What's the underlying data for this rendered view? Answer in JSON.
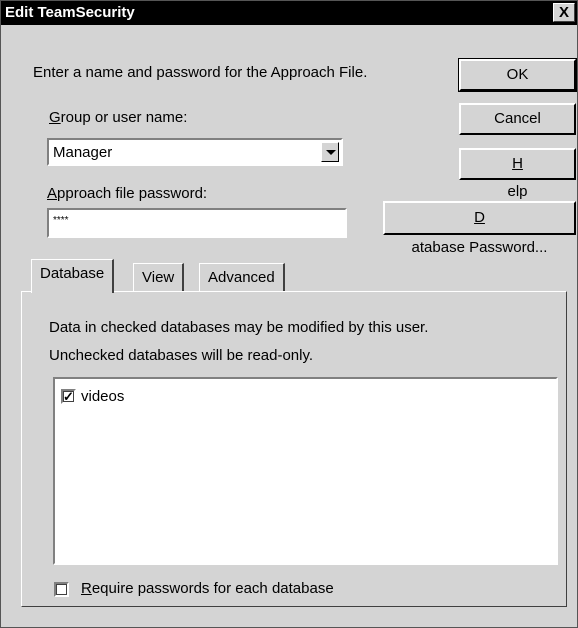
{
  "window": {
    "title": "Edit TeamSecurity",
    "close_label": "X"
  },
  "intro_text": "Enter a name and password for the Approach File.",
  "group": {
    "label_first": "G",
    "label_rest": "roup or user name:",
    "selected_value": "Manager"
  },
  "password": {
    "label_first": "A",
    "label_rest": "pproach file password:",
    "value": "****"
  },
  "buttons": {
    "ok": "OK",
    "cancel": "Cancel",
    "help_first": "H",
    "help_rest": "elp",
    "dbpass_first": "D",
    "dbpass_rest": "atabase Password..."
  },
  "tabs": [
    {
      "label": "Database"
    },
    {
      "label": "View"
    },
    {
      "label": "Advanced"
    }
  ],
  "panel": {
    "line1": "Data in checked databases may be modified by this user.",
    "line2": "Unchecked databases will be read-only.",
    "databases": [
      {
        "name": "videos",
        "checked": true
      }
    ],
    "require_first": "R",
    "require_rest": "equire passwords for each database",
    "require_checked": false
  }
}
